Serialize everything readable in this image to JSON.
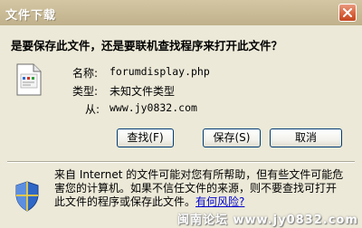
{
  "window": {
    "title": "文件下载"
  },
  "dialog": {
    "question": "是要保存此文件，还是要联机查找程序来打开此文件？",
    "file": {
      "name_label": "名称:",
      "name_value": "forumdisplay.php",
      "type_label": "类型:",
      "type_value": "未知文件类型",
      "from_label": "从:",
      "from_value": "www.jy0832.com"
    },
    "buttons": {
      "find": "查找(F)",
      "save": "保存(S)",
      "cancel": "取消"
    },
    "warning": {
      "text": "来自 Internet 的文件可能对您有所帮助，但有些文件可能危害您的计算机。如果不信任文件的来源，则不要查找可打开此文件的程序或保存此文件。",
      "link": "有何风险?"
    }
  },
  "watermark": "闽南论坛 www.jy0832.com",
  "icons": {
    "close": "close-icon",
    "file": "file-icon",
    "shield": "shield-icon"
  },
  "colors": {
    "titlebar": "#c0b18b",
    "close": "#d9653f",
    "link": "#0000cc"
  }
}
